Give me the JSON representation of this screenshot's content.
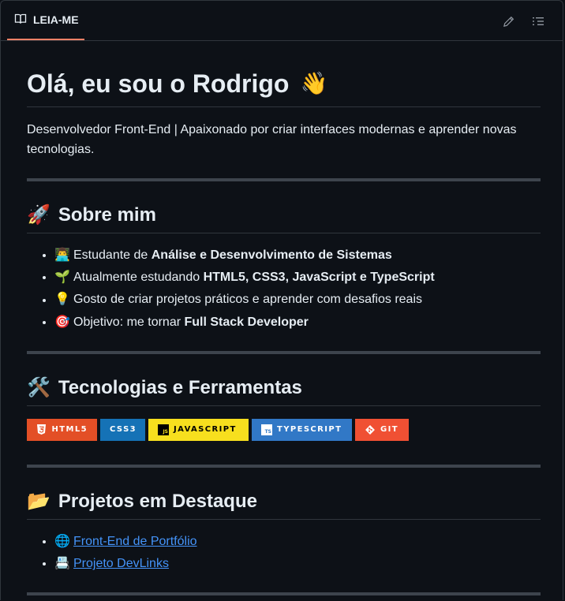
{
  "tab": {
    "label": "LEIA-ME"
  },
  "heading": {
    "title": "Olá, eu sou o Rodrigo",
    "emoji": "👋"
  },
  "intro": "Desenvolvedor Front-End | Apaixonado por criar interfaces modernas e aprender novas tecnologias.",
  "about": {
    "title": "Sobre mim",
    "emoji": "🚀",
    "items": [
      {
        "emoji": "👨‍💻",
        "text": "Estudante de ",
        "bold": "Análise e Desenvolvimento de Sistemas"
      },
      {
        "emoji": "🌱",
        "text": "Atualmente estudando ",
        "bold": "HTML5, CSS3, JavaScript e TypeScript"
      },
      {
        "emoji": "💡",
        "text": "Gosto de criar projetos práticos e aprender com desafios reais",
        "bold": ""
      },
      {
        "emoji": "🎯",
        "text": "Objetivo: me tornar ",
        "bold": "Full Stack Developer"
      }
    ]
  },
  "tech": {
    "title": "Tecnologias e Ferramentas",
    "emoji": "🛠️",
    "badges": [
      {
        "label": "HTML5",
        "bg": "#e34f26",
        "fg": "#ffffff",
        "icon": "html5-icon"
      },
      {
        "label": "CSS3",
        "bg": "#1572b6",
        "fg": "#ffffff",
        "icon": ""
      },
      {
        "label": "JAVASCRIPT",
        "bg": "#f7df1e",
        "fg": "#000000",
        "icon": "javascript-icon"
      },
      {
        "label": "TYPESCRIPT",
        "bg": "#3178c6",
        "fg": "#ffffff",
        "icon": "typescript-icon"
      },
      {
        "label": "GIT",
        "bg": "#f05033",
        "fg": "#ffffff",
        "icon": "git-icon"
      }
    ]
  },
  "projects": {
    "title": "Projetos em Destaque",
    "emoji": "📂",
    "items": [
      {
        "emoji": "🌐",
        "label": "Front-End de Portfólio"
      },
      {
        "emoji": "📇",
        "label": "Projeto DevLinks"
      }
    ]
  },
  "colors": {
    "accent": "#f78166",
    "link": "#4493f8",
    "background": "#0d1117"
  }
}
